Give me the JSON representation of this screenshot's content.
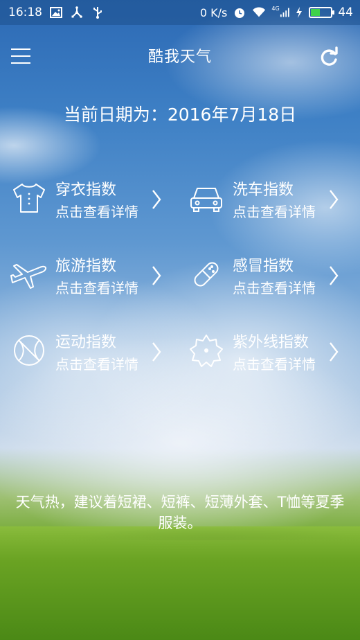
{
  "status_bar": {
    "time": "16:18",
    "network_speed": "0 K/s",
    "network_type": "4G",
    "battery_level": "44",
    "battery_fraction": 0.44,
    "icons": [
      "image-icon",
      "usb-share-icon",
      "usb-icon",
      "alarm-icon",
      "wifi-icon",
      "signal-icon",
      "charging-icon",
      "battery-icon"
    ]
  },
  "app_bar": {
    "title": "酷我天气",
    "menu_icon": "hamburger-menu-icon",
    "refresh_icon": "refresh-icon"
  },
  "date_text": "当前日期为：2016年7月18日",
  "indices": [
    {
      "title": "穿衣指数",
      "subtitle": "点击查看详情",
      "icon": "tshirt-icon"
    },
    {
      "title": "洗车指数",
      "subtitle": "点击查看详情",
      "icon": "car-icon"
    },
    {
      "title": "旅游指数",
      "subtitle": "点击查看详情",
      "icon": "airplane-icon"
    },
    {
      "title": "感冒指数",
      "subtitle": "点击查看详情",
      "icon": "pill-icon"
    },
    {
      "title": "运动指数",
      "subtitle": "点击查看详情",
      "icon": "ball-icon"
    },
    {
      "title": "紫外线指数",
      "subtitle": "点击查看详情",
      "icon": "umbrella-icon"
    }
  ],
  "advice": "天气热，建议着短裙、短裤、短薄外套、T恤等夏季服装。"
}
